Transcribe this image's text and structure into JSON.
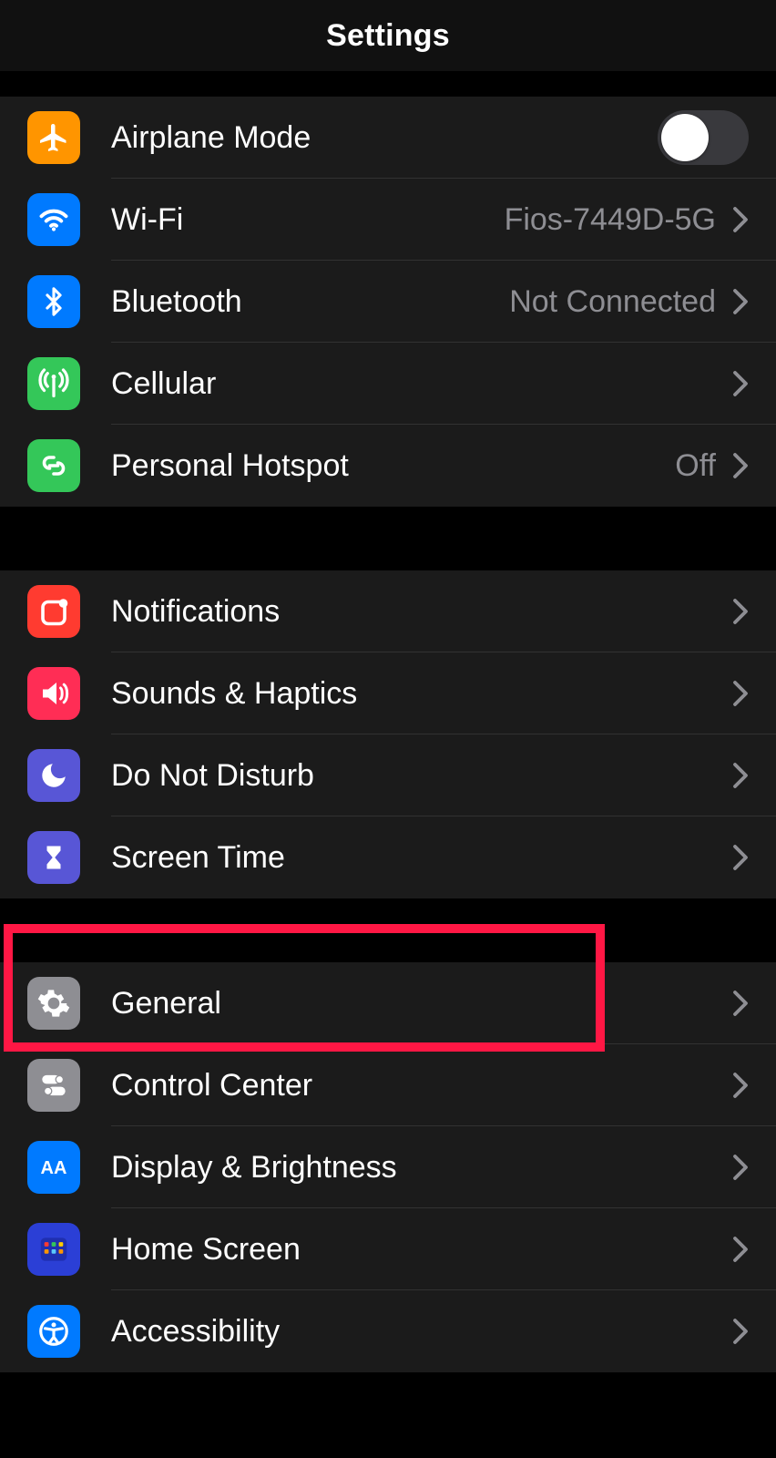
{
  "header": {
    "title": "Settings"
  },
  "group1": {
    "airplane": {
      "label": "Airplane Mode",
      "toggle": false
    },
    "wifi": {
      "label": "Wi-Fi",
      "value": "Fios-7449D-5G"
    },
    "bluetooth": {
      "label": "Bluetooth",
      "value": "Not Connected"
    },
    "cellular": {
      "label": "Cellular"
    },
    "hotspot": {
      "label": "Personal Hotspot",
      "value": "Off"
    }
  },
  "group2": {
    "notifications": {
      "label": "Notifications"
    },
    "sounds": {
      "label": "Sounds & Haptics"
    },
    "dnd": {
      "label": "Do Not Disturb"
    },
    "screentime": {
      "label": "Screen Time"
    }
  },
  "group3": {
    "general": {
      "label": "General"
    },
    "controlcenter": {
      "label": "Control Center"
    },
    "display": {
      "label": "Display & Brightness"
    },
    "homescreen": {
      "label": "Home Screen"
    },
    "accessibility": {
      "label": "Accessibility"
    }
  },
  "colors": {
    "orange": "#ff9500",
    "blue": "#007aff",
    "green": "#34c759",
    "red": "#ff3b30",
    "pink": "#ff2d55",
    "purple": "#5856d6",
    "gray": "#8e8e93",
    "highlight": "#ff1744"
  }
}
